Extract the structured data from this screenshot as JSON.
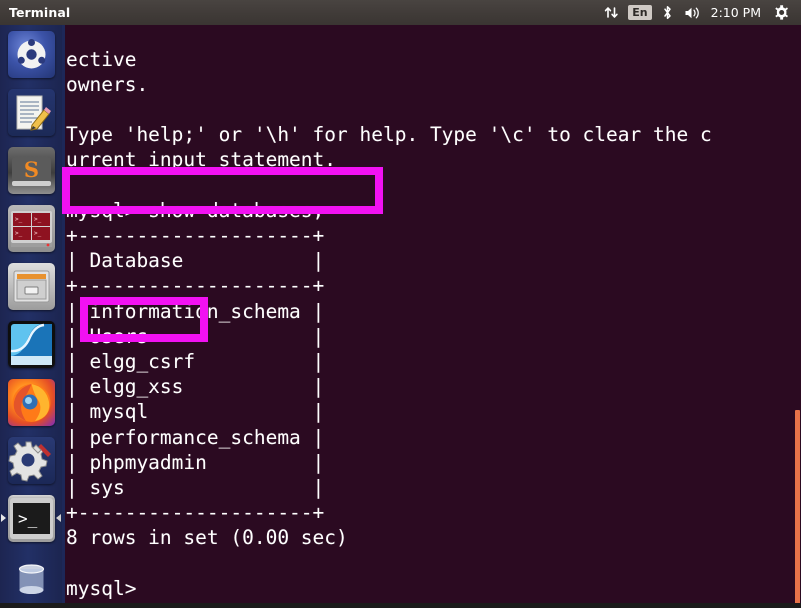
{
  "panel": {
    "title": "Terminal",
    "clock": "2:10 PM",
    "indicators": {
      "network": "network-updown-icon",
      "keyboard_label": "En",
      "bluetooth": "bluetooth-icon",
      "volume": "volume-icon",
      "session": "gear-icon"
    }
  },
  "launcher": {
    "items": [
      {
        "name": "ubuntu-dash",
        "label": "Ubuntu Dash",
        "icon": "ubuntu-logo-icon"
      },
      {
        "name": "text-editor",
        "label": "Text Editor",
        "icon": "document-pencil-icon"
      },
      {
        "name": "sublime-text",
        "label": "Sublime Text",
        "icon": "sublime-s-icon"
      },
      {
        "name": "terminator",
        "label": "Terminator",
        "icon": "red-terminal-panes-icon"
      },
      {
        "name": "file-manager",
        "label": "Files",
        "icon": "file-cabinet-icon"
      },
      {
        "name": "wireshark",
        "label": "Wireshark",
        "icon": "wireshark-fin-icon"
      },
      {
        "name": "firefox",
        "label": "Firefox",
        "icon": "firefox-icon"
      },
      {
        "name": "system-settings",
        "label": "System Settings",
        "icon": "gear-wrench-icon"
      },
      {
        "name": "terminal",
        "label": "Terminal",
        "icon": "terminal-prompt-icon",
        "active": true
      }
    ],
    "trash": {
      "name": "trash",
      "label": "Trash",
      "icon": "trash-bin-icon"
    }
  },
  "terminal": {
    "content": "ective\nowners.\n\nType 'help;' or '\\h' for help. Type '\\c' to clear the c\nurrent input statement.\n\nmysql> show databases;\n+--------------------+\n| Database           |\n+--------------------+\n| information_schema |\n| Users              |\n| elgg_csrf          |\n| elgg_xss           |\n| mysql              |\n| performance_schema |\n| phpmyadmin         |\n| sys                |\n+--------------------+\n8 rows in set (0.00 sec)\n\nmysql> ",
    "prompt": "mysql>",
    "command": "show databases;",
    "result_table": {
      "border": "+--------------------+",
      "header": "Database",
      "rows": [
        "information_schema",
        "Users",
        "elgg_csrf",
        "elgg_xss",
        "mysql",
        "performance_schema",
        "phpmyadmin",
        "sys"
      ]
    },
    "row_count_text": "8 rows in set (0.00 sec)",
    "background_color": "#2b0a21",
    "text_color": "#ffffff",
    "scrollbar_color": "#e8734a"
  },
  "annotations": {
    "color": "#f211f2",
    "boxes": [
      {
        "name": "show-databases-command-highlight",
        "target": "mysql> show databases;"
      },
      {
        "name": "users-database-highlight",
        "target": "Users"
      }
    ]
  }
}
